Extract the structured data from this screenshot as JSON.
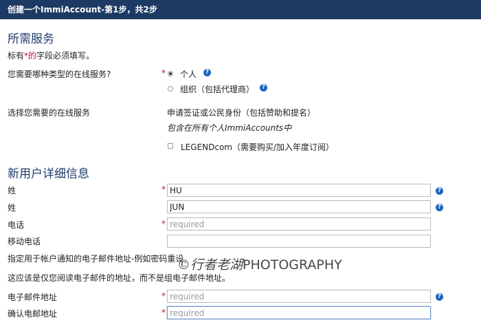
{
  "header": {
    "title": "创建一个ImmiAccount-第1步，共2步"
  },
  "services_section": {
    "title": "所需服务",
    "required_note_prefix": "标有",
    "required_note_mark": "*的",
    "required_note_suffix": "字段必须填写。",
    "service_type_label": "您需要哪种类型的在线服务?",
    "options": [
      {
        "label": "个人",
        "checked": true
      },
      {
        "label": "组织（包括代理商）",
        "checked": false
      }
    ],
    "online_service_label": "选择您需要的在线服务",
    "service_item": "申请签证或公民身份（包括赞助和提名）",
    "service_included_note": "包含在所有个人ImmiAccounts中",
    "legendcom_label": "LEGENDcom（需要购买/加入年度订阅）"
  },
  "user_section": {
    "title": "新用户详细信息",
    "surname_label": "姓",
    "surname_value": "HU",
    "given_name_label": "姓",
    "given_name_value": "JUN",
    "phone_label": "电话",
    "phone_placeholder": "required",
    "mobile_label": "移动电话",
    "email_hint": "指定用于帐户通知的电子邮件地址-例如密码重设",
    "email_note": "这应该是仅您阅读电子邮件的地址，而不是组电子邮件地址。",
    "email_label": "电子邮件地址",
    "email_placeholder": "required",
    "confirm_email_label": "确认电邮地址",
    "confirm_email_placeholder": "required"
  },
  "required_marker": "*",
  "help_glyph": "?",
  "watermark": {
    "symbol": "©",
    "script": "行者老湖",
    "text": "PHOTOGRAPHY"
  },
  "icons": {
    "help": "help-circle-icon"
  },
  "colors": {
    "header_bg": "#1c3a64",
    "section_title": "#1f3d6b",
    "required": "#c8102e",
    "help_icon": "#1a66c2"
  }
}
